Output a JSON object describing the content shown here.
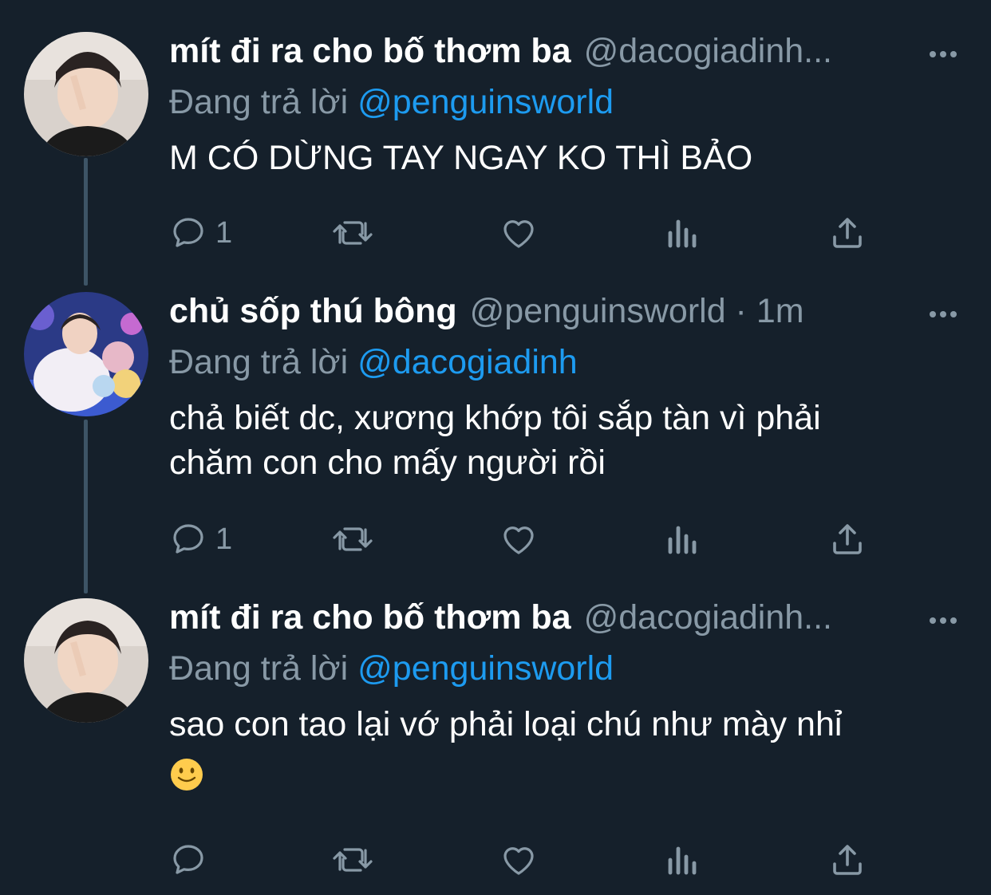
{
  "colors": {
    "background": "#15202b",
    "muted": "#8899a6",
    "link": "#1d9bf0",
    "thread_line": "#3d5466"
  },
  "tweets": [
    {
      "display_name": "mít đi ra cho bố thơm ba",
      "handle": "@dacogiadinh...",
      "reply_prefix": "Đang trả lời",
      "reply_to": "@penguinsworld",
      "lines": [
        "M CÓ DỪNG TAY NGAY KO THÌ BẢO"
      ],
      "reply_count": "1",
      "avatar": "avatar-boy-peace-sign"
    },
    {
      "display_name": "chủ sốp thú bông",
      "handle": "@penguinsworld · 1m",
      "reply_prefix": "Đang trả lời",
      "reply_to": "@dacogiadinh",
      "lines": [
        "chả biết dc, xương khớp tôi sắp tàn vì phải",
        "chăm con cho mấy người rồi"
      ],
      "reply_count": "1",
      "avatar": "avatar-plush-toys"
    },
    {
      "display_name": "mít đi ra cho bố thơm ba",
      "handle": "@dacogiadinh...",
      "reply_prefix": "Đang trả lời",
      "reply_to": "@penguinsworld",
      "lines": [
        "sao con tao lại vớ phải loại chú như mày nhỉ"
      ],
      "reply_count": "",
      "emoji": "slightly-smiling-face-emoji",
      "avatar": "avatar-boy-peace-sign"
    }
  ],
  "icons": [
    "reply-icon",
    "retweet-icon",
    "like-icon",
    "analytics-icon",
    "share-icon",
    "more-icon"
  ]
}
